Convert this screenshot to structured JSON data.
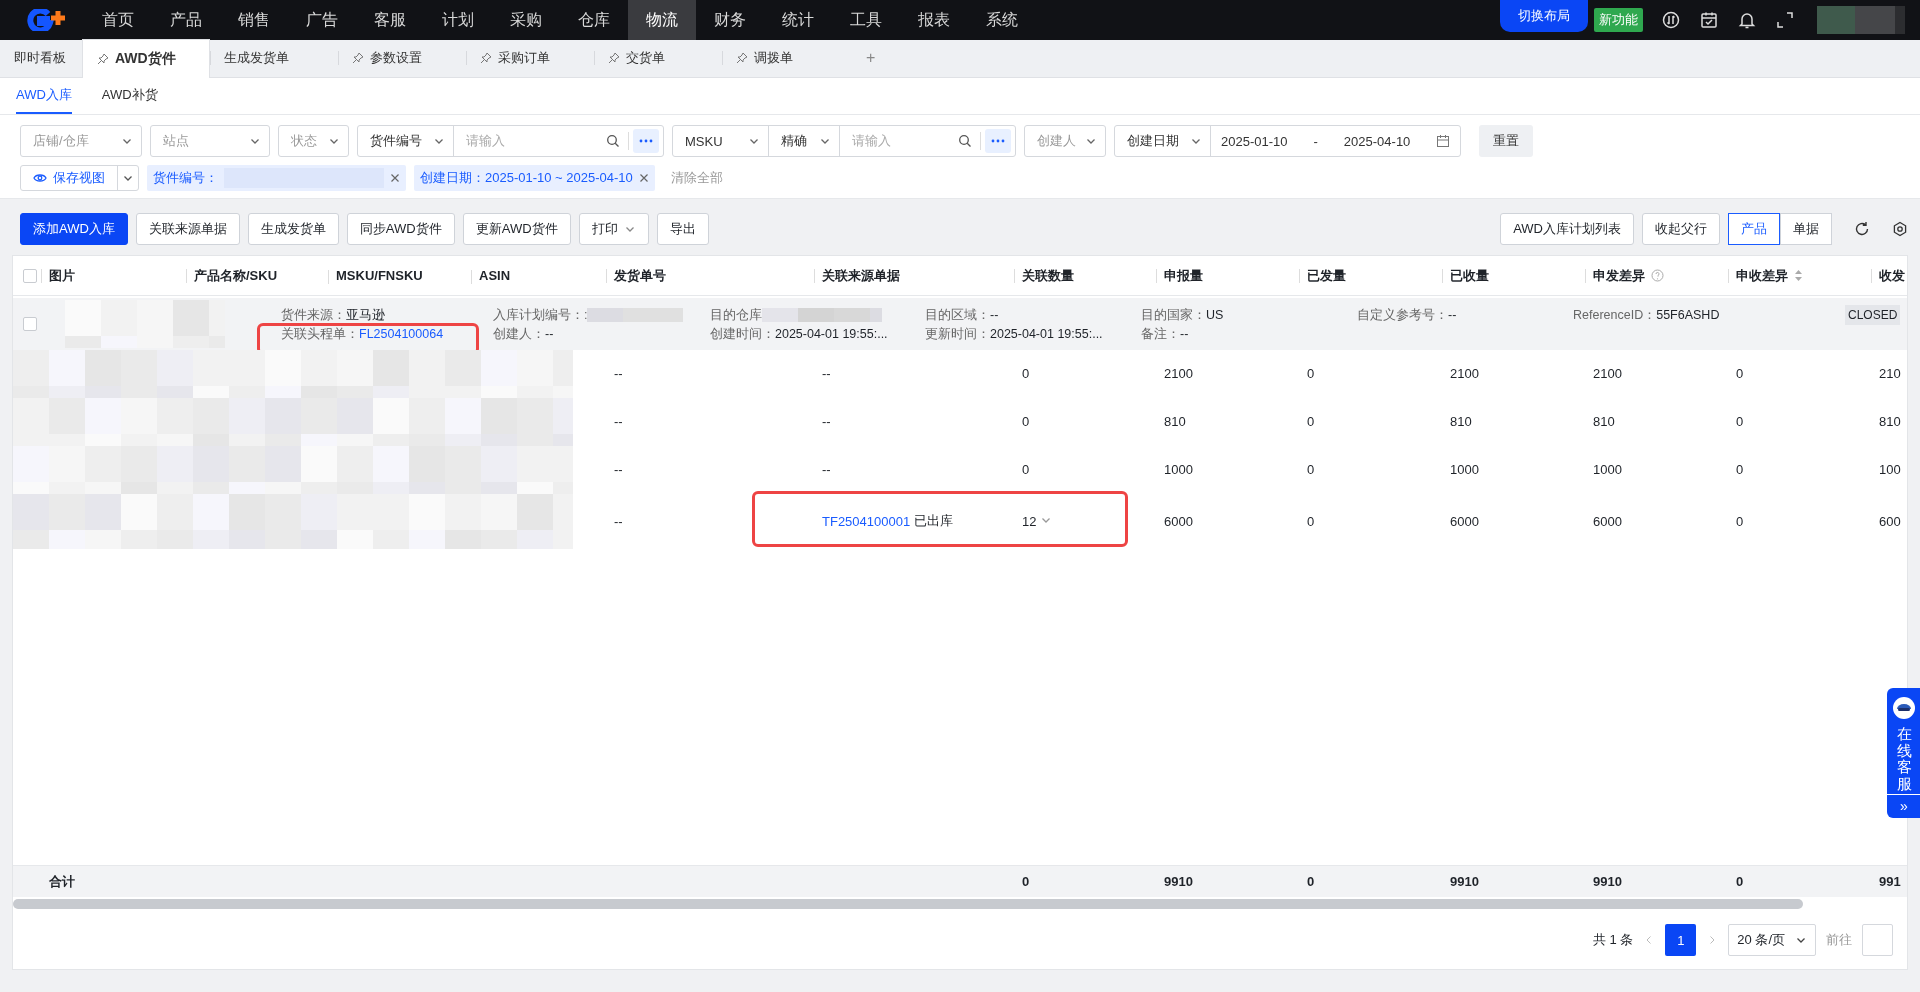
{
  "nav": {
    "items": [
      {
        "label": "首页",
        "selected": false
      },
      {
        "label": "产品",
        "selected": false
      },
      {
        "label": "销售",
        "selected": false
      },
      {
        "label": "广告",
        "selected": false
      },
      {
        "label": "客服",
        "selected": false
      },
      {
        "label": "计划",
        "selected": false
      },
      {
        "label": "采购",
        "selected": false
      },
      {
        "label": "仓库",
        "selected": false
      },
      {
        "label": "物流",
        "selected": true
      },
      {
        "label": "财务",
        "selected": false
      },
      {
        "label": "统计",
        "selected": false
      },
      {
        "label": "工具",
        "selected": false
      },
      {
        "label": "报表",
        "selected": false
      },
      {
        "label": "系统",
        "selected": false
      }
    ],
    "layout_button": "切换布局",
    "new_badge": "新功能"
  },
  "tabs": [
    {
      "label": "即时看板",
      "pinned": false,
      "selected": false
    },
    {
      "label": "AWD货件",
      "pinned": true,
      "selected": true
    },
    {
      "label": "生成发货单",
      "pinned": false,
      "selected": false
    },
    {
      "label": "参数设置",
      "pinned": true,
      "selected": false
    },
    {
      "label": "采购订单",
      "pinned": true,
      "selected": false
    },
    {
      "label": "交货单",
      "pinned": true,
      "selected": false
    },
    {
      "label": "调拨单",
      "pinned": true,
      "selected": false
    }
  ],
  "add_tab": "+",
  "subtabs": [
    {
      "label": "AWD入库",
      "selected": true
    },
    {
      "label": "AWD补货",
      "selected": false
    }
  ],
  "filters": {
    "store": {
      "placeholder": "店铺/仓库"
    },
    "site": {
      "placeholder": "站点"
    },
    "status": {
      "placeholder": "状态"
    },
    "shipment_field": "货件编号",
    "shipment_search": {
      "placeholder": "请输入"
    },
    "msku_field": "MSKU",
    "match_mode": "精确",
    "msku_search": {
      "placeholder": "请输入"
    },
    "creator": {
      "placeholder": "创建人"
    },
    "date_field": "创建日期",
    "date_from": "2025-01-10",
    "date_sep": "-",
    "date_to": "2025-04-10",
    "reset": "重置"
  },
  "save_view": "保存视图",
  "chips": [
    {
      "label": "货件编号：",
      "redacted": true
    },
    {
      "label": "创建日期：2025-01-10 ~ 2025-04-10",
      "redacted": false
    }
  ],
  "clear_all": "清除全部",
  "actions": [
    {
      "label": "添加AWD入库",
      "primary": true,
      "dropdown": false
    },
    {
      "label": "关联来源单据",
      "primary": false,
      "dropdown": false
    },
    {
      "label": "生成发货单",
      "primary": false,
      "dropdown": false
    },
    {
      "label": "同步AWD货件",
      "primary": false,
      "dropdown": false
    },
    {
      "label": "更新AWD货件",
      "primary": false,
      "dropdown": false
    },
    {
      "label": "打印",
      "primary": false,
      "dropdown": true
    },
    {
      "label": "导出",
      "primary": false,
      "dropdown": false
    }
  ],
  "right_actions": [
    "AWD入库计划列表",
    "收起父行"
  ],
  "view_toggle": [
    {
      "label": "产品",
      "selected": true
    },
    {
      "label": "单据",
      "selected": false
    }
  ],
  "table": {
    "columns": [
      {
        "label": "图片",
        "kind": "plain"
      },
      {
        "label": "产品名称/SKU",
        "kind": "plain"
      },
      {
        "label": "MSKU/FNSKU",
        "kind": "plain"
      },
      {
        "label": "ASIN",
        "kind": "plain"
      },
      {
        "label": "发货单号",
        "kind": "plain"
      },
      {
        "label": "关联来源单据",
        "kind": "plain"
      },
      {
        "label": "关联数量",
        "kind": "plain"
      },
      {
        "label": "申报量",
        "kind": "plain"
      },
      {
        "label": "已发量",
        "kind": "plain"
      },
      {
        "label": "已收量",
        "kind": "plain"
      },
      {
        "label": "申发差异",
        "kind": "help"
      },
      {
        "label": "申收差异",
        "kind": "sort"
      },
      {
        "label": "收发",
        "kind": "plain"
      }
    ],
    "select_all_checked": false,
    "group": {
      "checked": false,
      "blocks": [
        [
          {
            "label": "货件来源：",
            "value": "亚马逊",
            "kind": "text",
            "highlighted": false
          },
          {
            "label": "关联头程单：",
            "value": "FL2504100064",
            "kind": "link",
            "highlighted": true
          }
        ],
        [
          {
            "label": "入库计划编号：:",
            "kind": "redacted",
            "highlighted": false
          },
          {
            "label": "创建人：",
            "text": "--",
            "kind": "text",
            "highlighted": false
          }
        ],
        [
          {
            "label": "目的仓库",
            "kind": "redacted",
            "highlighted": false
          },
          {
            "label": "创建时间：",
            "value": "2025-04-01 19:55:...",
            "kind": "text",
            "highlighted": false
          }
        ],
        [
          {
            "label": "目的区域：",
            "text": "--",
            "kind": "text",
            "highlighted": false
          },
          {
            "label": "更新时间：",
            "value": "2025-04-01 19:55:...",
            "kind": "text",
            "highlighted": false
          }
        ],
        [
          {
            "label": "目的国家：",
            "value": "US",
            "kind": "text",
            "highlighted": false
          },
          {
            "label": "备注：",
            "text": "--",
            "kind": "text",
            "highlighted": false
          }
        ],
        [
          {
            "label": "自定义参考号：",
            "text": "--",
            "kind": "text",
            "highlighted": false
          }
        ],
        [
          {
            "label": "ReferenceID：",
            "value": "55F6ASHD",
            "kind": "text",
            "highlighted": false
          }
        ]
      ],
      "status": "CLOSED"
    },
    "rows": [
      {
        "shipment_no": "--",
        "source_doc": "--",
        "kind": "text",
        "linked_qty": "0",
        "expandable": false,
        "declared": "2100",
        "shipped": "0",
        "received": "2100",
        "diff_declared_shipped": "2100",
        "diff_declared_received": "0",
        "column_14": "210",
        "highlighted": false
      },
      {
        "shipment_no": "--",
        "source_doc": "--",
        "kind": "text",
        "linked_qty": "0",
        "expandable": false,
        "declared": "810",
        "shipped": "0",
        "received": "810",
        "diff_declared_shipped": "810",
        "diff_declared_received": "0",
        "column_14": "810",
        "highlighted": false
      },
      {
        "shipment_no": "--",
        "source_doc": "--",
        "kind": "text",
        "linked_qty": "0",
        "expandable": false,
        "declared": "1000",
        "shipped": "0",
        "received": "1000",
        "diff_declared_shipped": "1000",
        "diff_declared_received": "0",
        "column_14": "100",
        "highlighted": false
      },
      {
        "shipment_no": "--",
        "source_doc": "TF2504100001",
        "kind": "link",
        "source_status": "已出库",
        "linked_qty": "12",
        "expandable": true,
        "declared": "6000",
        "shipped": "0",
        "received": "6000",
        "diff_declared_shipped": "6000",
        "diff_declared_received": "0",
        "column_14": "600",
        "highlighted": true
      }
    ],
    "total": {
      "label": "合计",
      "linked_qty": "0",
      "declared": "9910",
      "shipped": "0",
      "received": "9910",
      "diff_declared_shipped": "9910",
      "diff_declared_received": "0",
      "column_14": "991"
    }
  },
  "pagination": {
    "summary": "共 1 条",
    "pages": [
      {
        "label": "1",
        "selected": true
      }
    ],
    "page_size": "20 条/页",
    "goto_label": "前往"
  },
  "service": {
    "label": "在线客服",
    "collapse": "»"
  }
}
